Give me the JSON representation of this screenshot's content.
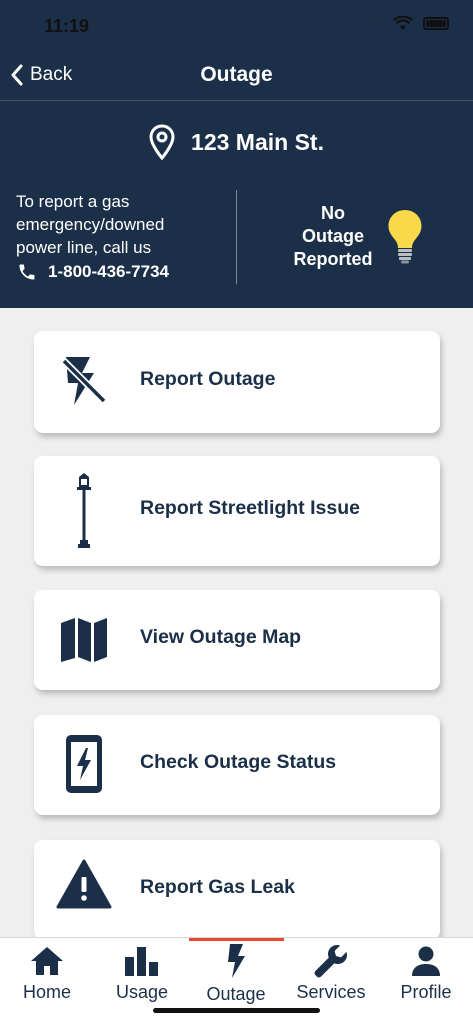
{
  "status_bar": {
    "time": "11:19",
    "signal": "····"
  },
  "nav": {
    "back_label": "Back",
    "title": "Outage"
  },
  "address": "123 Main St.",
  "emergency": {
    "line1": "To report a gas",
    "line2": "emergency/downed",
    "line3": "power line, call us",
    "phone": "1-800-436-7734"
  },
  "outage_status": {
    "line1": "No",
    "line2": "Outage",
    "line3": "Reported"
  },
  "actions": [
    {
      "label": "Report Outage",
      "icon": "power-off-icon"
    },
    {
      "label": "Report Streetlight Issue",
      "icon": "streetlight-icon"
    },
    {
      "label": "View Outage Map",
      "icon": "map-icon"
    },
    {
      "label": "Check Outage Status",
      "icon": "phone-status-icon"
    },
    {
      "label": "Report Gas Leak",
      "icon": "warning-icon"
    }
  ],
  "tabs": [
    {
      "label": "Home",
      "icon": "home-icon"
    },
    {
      "label": "Usage",
      "icon": "bar-chart-icon"
    },
    {
      "label": "Outage",
      "icon": "bolt-icon",
      "active": true
    },
    {
      "label": "Services",
      "icon": "wrench-icon"
    },
    {
      "label": "Profile",
      "icon": "person-icon"
    }
  ],
  "colors": {
    "navy": "#1b3048",
    "accent": "#e64a2e",
    "bulb": "#f9d84a",
    "background": "#efeff0"
  }
}
